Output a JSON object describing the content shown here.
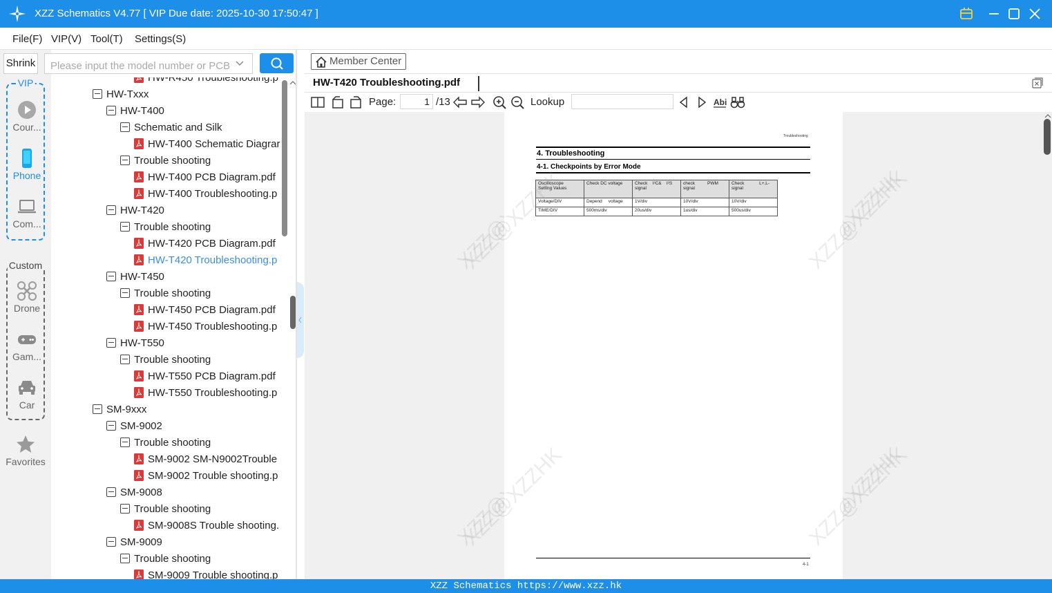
{
  "window": {
    "title": "XZZ Schematics V4.77 [ VIP Due date: 2025-10-30 17:50:47 ]"
  },
  "menu": [
    "File(F)",
    "VIP(V)",
    "Tool(T)",
    "Settings(S)"
  ],
  "sidebar": {
    "shrink_label": "Shrink",
    "vip_group": "VIP",
    "vip_items": [
      "Cour...",
      "Phone",
      "Com..."
    ],
    "custom_group": "Custom",
    "custom_items": [
      "Drone",
      "Gam...",
      "Car"
    ],
    "favorites": "Favorites"
  },
  "search": {
    "placeholder": "Please input the model number or PCB"
  },
  "tree": [
    {
      "level": 3,
      "label": "HW-R450 Troubleshooting.p",
      "type": "pdf"
    },
    {
      "level": 0,
      "label": "HW-Txxx",
      "type": "folder"
    },
    {
      "level": 1,
      "label": "HW-T400",
      "type": "folder"
    },
    {
      "level": 2,
      "label": "Schematic and Silk",
      "type": "folder"
    },
    {
      "level": 3,
      "label": "HW-T400 Schematic Diagrar",
      "type": "pdf"
    },
    {
      "level": 2,
      "label": "Trouble shooting",
      "type": "folder"
    },
    {
      "level": 3,
      "label": "HW-T400 PCB Diagram.pdf",
      "type": "pdf"
    },
    {
      "level": 3,
      "label": "HW-T400 Troubleshooting.p",
      "type": "pdf"
    },
    {
      "level": 1,
      "label": "HW-T420",
      "type": "folder"
    },
    {
      "level": 2,
      "label": "Trouble shooting",
      "type": "folder"
    },
    {
      "level": 3,
      "label": "HW-T420 PCB Diagram.pdf",
      "type": "pdf"
    },
    {
      "level": 3,
      "label": "HW-T420 Troubleshooting.p",
      "type": "pdf",
      "selected": true
    },
    {
      "level": 1,
      "label": "HW-T450",
      "type": "folder"
    },
    {
      "level": 2,
      "label": "Trouble shooting",
      "type": "folder"
    },
    {
      "level": 3,
      "label": "HW-T450 PCB Diagram.pdf",
      "type": "pdf"
    },
    {
      "level": 3,
      "label": "HW-T450 Troubleshooting.p",
      "type": "pdf"
    },
    {
      "level": 1,
      "label": "HW-T550",
      "type": "folder"
    },
    {
      "level": 2,
      "label": "Trouble shooting",
      "type": "folder"
    },
    {
      "level": 3,
      "label": "HW-T550 PCB Diagram.pdf",
      "type": "pdf"
    },
    {
      "level": 3,
      "label": "HW-T550 Troubleshooting.p",
      "type": "pdf"
    },
    {
      "level": 0,
      "label": "SM-9xxx",
      "type": "folder"
    },
    {
      "level": 1,
      "label": "SM-9002",
      "type": "folder"
    },
    {
      "level": 2,
      "label": "Trouble shooting",
      "type": "folder"
    },
    {
      "level": 3,
      "label": "SM-9002 SM-N9002Trouble",
      "type": "pdf"
    },
    {
      "level": 3,
      "label": "SM-9002 Trouble shooting.p",
      "type": "pdf"
    },
    {
      "level": 1,
      "label": "SM-9008",
      "type": "folder"
    },
    {
      "level": 2,
      "label": "Trouble shooting",
      "type": "folder"
    },
    {
      "level": 3,
      "label": "SM-9008S Trouble shooting.",
      "type": "pdf"
    },
    {
      "level": 1,
      "label": "SM-9009",
      "type": "folder"
    },
    {
      "level": 2,
      "label": "Trouble shooting",
      "type": "folder"
    },
    {
      "level": 3,
      "label": "SM-9009 Trouble shooting.p",
      "type": "pdf"
    }
  ],
  "member_center": "Member Center",
  "document": {
    "tab_title": "HW-T420 Troubleshooting.pdf",
    "page_label": "Page:",
    "page_current": "1",
    "page_total": "/13",
    "lookup_label": "Lookup",
    "watermark": "XZZ@XZZHK",
    "pdf": {
      "header_right": "Troubleshooting",
      "section_title": "4.  Troubleshooting",
      "subsection_title": "4-1.  Checkpoints by Error Mode",
      "table": [
        [
          "Oscilloscope\nSetting Values",
          "Check DC voltage",
          "Check    I²C&    I²S\nsignal",
          "check          PWM\nsignal",
          "Check            L+,L-\nsignal"
        ],
        [
          "Voltage/DIV",
          "Depend     voltage",
          "1V/div",
          "10V/div",
          "10V/div"
        ],
        [
          "TIME/DIV",
          "500ms/div",
          "20us/div",
          "1us/div",
          "500us/div"
        ]
      ],
      "footer_page": "4-1"
    }
  },
  "status_bar": "XZZ Schematics https://www.xzz.hk",
  "colors": {
    "accent": "#1e8fe9",
    "selected_item": "#3a8ee6",
    "pdf_icon": "#d93a3a"
  }
}
